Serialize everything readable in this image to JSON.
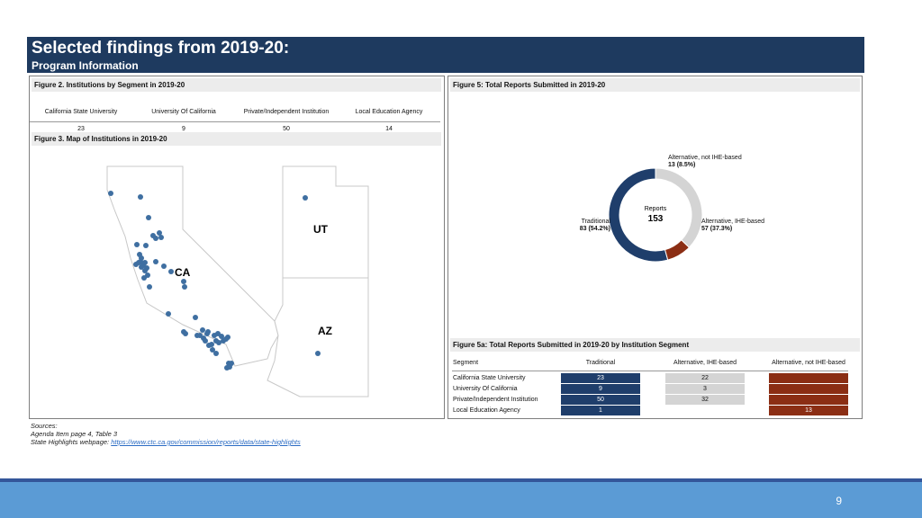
{
  "slide": {
    "title": "Selected findings from 2019-20:",
    "subtitle": "Program Information",
    "page_number": "9"
  },
  "figure2": {
    "title": "Figure 2. Institutions by Segment in 2019-20",
    "headers": [
      "California State University",
      "University Of California",
      "Private/Independent Institution",
      "Local Education Agency"
    ],
    "values": [
      "23",
      "9",
      "50",
      "14"
    ]
  },
  "figure3": {
    "title": "Figure 3. Map of Institutions in 2019-20",
    "state_labels": [
      "CA",
      "UT",
      "AZ"
    ]
  },
  "figure5": {
    "title": "Figure 5: Total Reports Submitted in 2019-20",
    "center_label": "Reports",
    "center_value": "153",
    "colors": {
      "traditional": "#1f3e6b",
      "alt_ihe": "#d4d4d4",
      "alt_not_ihe": "#8b2e14"
    },
    "slices": [
      {
        "name": "Traditional",
        "value": 83,
        "pct_label": "83 (54.2%)"
      },
      {
        "name": "Alternative, IHE-based",
        "value": 57,
        "pct_label": "57 (37.3%)"
      },
      {
        "name": "Alternative, not IHE-based",
        "value": 13,
        "pct_label": "13 (8.5%)"
      }
    ]
  },
  "figure5a": {
    "title": "Figure 5a: Total Reports Submitted in 2019-20 by Institution Segment",
    "headers": [
      "Segment",
      "Traditional",
      "Alternative, IHE-based",
      "Alternative, not IHE-based"
    ],
    "rows": [
      {
        "segment": "California State University",
        "traditional": "23",
        "alt_ihe": "22",
        "alt_not_ihe": ""
      },
      {
        "segment": "University Of California",
        "traditional": "9",
        "alt_ihe": "3",
        "alt_not_ihe": ""
      },
      {
        "segment": "Private/Independent Institution",
        "traditional": "50",
        "alt_ihe": "32",
        "alt_not_ihe": ""
      },
      {
        "segment": "Local Education Agency",
        "traditional": "1",
        "alt_ihe": "",
        "alt_not_ihe": "13"
      }
    ]
  },
  "sources": {
    "heading": "Sources:",
    "line1": "Agenda Item page 4, Table 3",
    "line2_prefix": "State Highlights webpage: ",
    "link": "https://www.ctc.ca.gov/commission/reports/data/state-highlights"
  }
}
